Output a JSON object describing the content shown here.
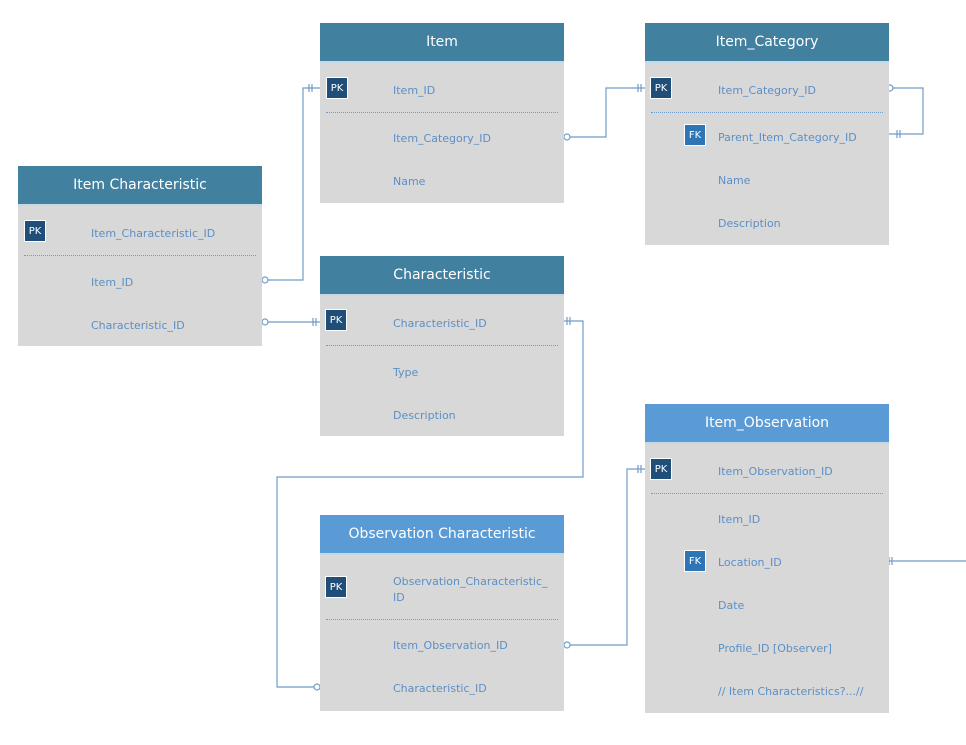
{
  "colors": {
    "header_dark": "#41809f",
    "header_light": "#5b9bd5",
    "body": "#d8d8d8",
    "field_text": "#5b8fc7",
    "pk": "#1f4e79",
    "fk": "#2e75b6",
    "line": "#6f9cc8"
  },
  "entities": {
    "item": {
      "title": "Item",
      "pk": "PK",
      "fields": [
        "Item_ID",
        "Item_Category_ID",
        "Name"
      ]
    },
    "item_category": {
      "title": "Item_Category",
      "pk": "PK",
      "fk": "FK",
      "fields": [
        "Item_Category_ID",
        "Parent_Item_Category_ID",
        "Name",
        "Description"
      ]
    },
    "item_characteristic": {
      "title": "Item Characteristic",
      "pk": "PK",
      "fields": [
        "Item_Characteristic_ID",
        "Item_ID",
        "Characteristic_ID"
      ]
    },
    "characteristic": {
      "title": "Characteristic",
      "pk": "PK",
      "fields": [
        "Characteristic_ID",
        "Type",
        "Description"
      ]
    },
    "observation_characteristic": {
      "title": "Observation Characteristic",
      "pk": "PK",
      "fields": [
        "Observation_Characteristic_",
        "ID",
        "Item_Observation_ID",
        "Characteristic_ID"
      ]
    },
    "item_observation": {
      "title": "Item_Observation",
      "pk": "PK",
      "fk": "FK",
      "fields": [
        "Item_Observation_ID",
        "Item_ID",
        "Location_ID",
        "Date",
        "Profile_ID [Observer]",
        "// Item Characteristics?...//"
      ]
    }
  }
}
